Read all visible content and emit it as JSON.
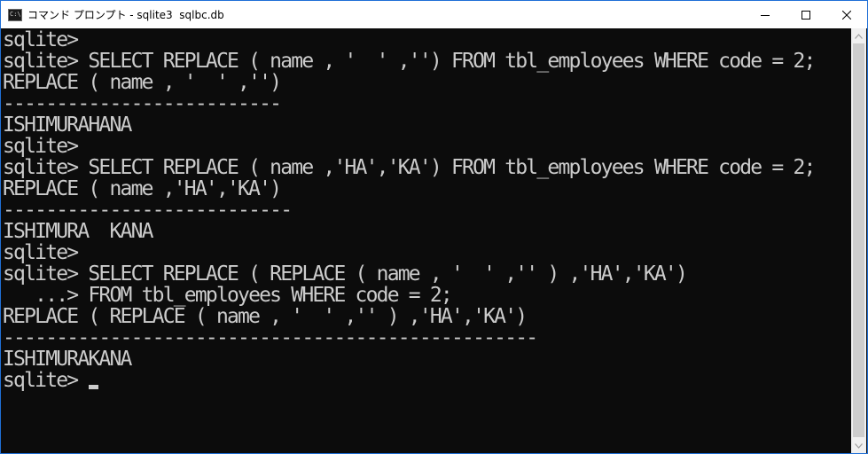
{
  "window": {
    "title": "コマンド プロンプト - sqlite3  sqlbc.db",
    "accent": "#1f6fd6"
  },
  "controls": {
    "minimize_icon": "minimize-icon",
    "maximize_icon": "maximize-icon",
    "close_icon": "close-icon"
  },
  "console": {
    "foreground": "#cccccc",
    "background": "#0c0c0c",
    "lines": [
      "sqlite>",
      "sqlite> SELECT REPLACE ( name , '  ' ,'') FROM tbl_employees WHERE code = 2;",
      "REPLACE ( name , '  ' ,'')",
      "--------------------------",
      "ISHIMURAHANA",
      "sqlite>",
      "sqlite> SELECT REPLACE ( name ,'HA','KA') FROM tbl_employees WHERE code = 2;",
      "REPLACE ( name ,'HA','KA')",
      "---------------------------",
      "ISHIMURA  KANA",
      "sqlite>",
      "sqlite> SELECT REPLACE ( REPLACE ( name , '  ' ,'' ) ,'HA','KA')",
      "   ...> FROM tbl_employees WHERE code = 2;",
      "REPLACE ( REPLACE ( name , '  ' ,'' ) ,'HA','KA')",
      "--------------------------------------------------",
      "ISHIMURAKANA",
      "sqlite>"
    ]
  }
}
